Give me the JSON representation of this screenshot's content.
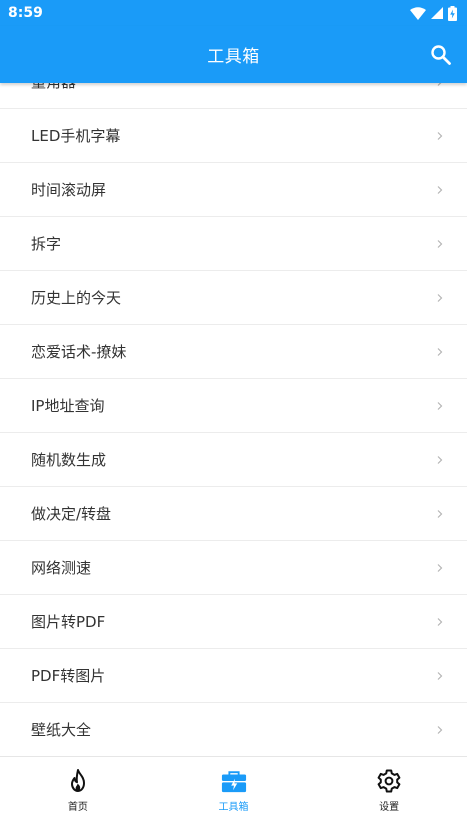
{
  "status_bar": {
    "time": "8:59"
  },
  "app_bar": {
    "title": "工具箱"
  },
  "list": {
    "items": [
      {
        "label": "量角器"
      },
      {
        "label": "LED手机字幕"
      },
      {
        "label": "时间滚动屏"
      },
      {
        "label": "拆字"
      },
      {
        "label": "历史上的今天"
      },
      {
        "label": "恋爱话术-撩妹"
      },
      {
        "label": "IP地址查询"
      },
      {
        "label": "随机数生成"
      },
      {
        "label": "做决定/转盘"
      },
      {
        "label": "网络测速"
      },
      {
        "label": "图片转PDF"
      },
      {
        "label": "PDF转图片"
      },
      {
        "label": "壁纸大全"
      }
    ]
  },
  "bottom_nav": {
    "items": [
      {
        "label": "首页",
        "icon": "flame-icon",
        "active": false
      },
      {
        "label": "工具箱",
        "icon": "toolbox-icon",
        "active": true
      },
      {
        "label": "设置",
        "icon": "gear-icon",
        "active": false
      }
    ]
  },
  "colors": {
    "primary": "#1a9bf8",
    "text": "#333333",
    "divider": "#ececec"
  }
}
